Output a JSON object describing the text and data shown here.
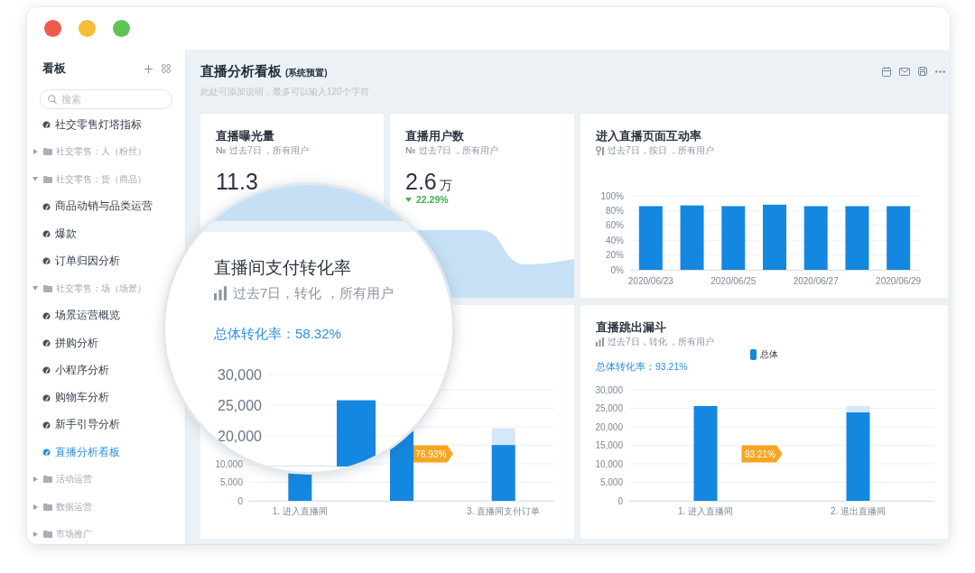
{
  "sidebar": {
    "title": "看板",
    "search": {
      "placeholder": "搜索"
    },
    "items": [
      {
        "kind": "dashboard",
        "label": "社交零售灯塔指标",
        "selected": false
      },
      {
        "kind": "folder",
        "label": "社交零售：人（粉丝）",
        "expanded": false
      },
      {
        "kind": "folder",
        "label": "社交零售：货（商品）",
        "expanded": true,
        "children": [
          {
            "kind": "dashboard",
            "label": "商品动销与品类运营",
            "selected": false
          },
          {
            "kind": "dashboard",
            "label": "爆款",
            "selected": false
          },
          {
            "kind": "dashboard",
            "label": "订单归因分析",
            "selected": false
          }
        ]
      },
      {
        "kind": "folder",
        "label": "社交零售：场（场景）",
        "expanded": true,
        "children": [
          {
            "kind": "dashboard",
            "label": "场景运营概览",
            "selected": false
          },
          {
            "kind": "dashboard",
            "label": "拼购分析",
            "selected": false
          },
          {
            "kind": "dashboard",
            "label": "小程序分析",
            "selected": false
          },
          {
            "kind": "dashboard",
            "label": "购物车分析",
            "selected": false
          },
          {
            "kind": "dashboard",
            "label": "新手引导分析",
            "selected": false
          },
          {
            "kind": "dashboard",
            "label": "直播分析看板",
            "selected": true
          }
        ]
      },
      {
        "kind": "folder",
        "label": "活动运营",
        "expanded": false
      },
      {
        "kind": "folder",
        "label": "数据运营",
        "expanded": false
      },
      {
        "kind": "folder",
        "label": "市场推广",
        "expanded": false
      }
    ]
  },
  "header": {
    "title": "直播分析看板",
    "tag": "(系统预置)",
    "description": "此处可添加说明，最多可以输入120个字符"
  },
  "card_rows": [
    {
      "cards": [
        {
          "kind": "metric",
          "title": "直播曝光量",
          "icon": "№",
          "subtitle": "过去7日 ，所有用户",
          "value": "11.3"
        },
        {
          "kind": "metric",
          "title": "直播用户数",
          "icon": "№",
          "subtitle": "过去7日 ，所有用户",
          "value": "2.6",
          "unit": "万",
          "change": {
            "text": "22.29%",
            "down": true
          },
          "area_chart": true
        },
        {
          "kind": "bar_chart",
          "title": "进入直播页面互动率",
          "subtitle": "过去7日，按日 ，所有用户",
          "chart_data": {
            "type": "bar",
            "categories": [
              "2020/06/23",
              null,
              "2020/06/25",
              null,
              "2020/06/27",
              null,
              "2020/06/29"
            ],
            "ylim": [
              0,
              100
            ],
            "yticks": [
              {
                "value": 0,
                "label": "0%"
              },
              {
                "value": 20,
                "label": "20%"
              },
              {
                "value": 40,
                "label": "40%"
              },
              {
                "value": 60,
                "label": "60%"
              },
              {
                "value": 80,
                "label": "80%"
              },
              {
                "value": 100,
                "label": "100%"
              }
            ],
            "grid": true,
            "series": [
              {
                "color": "#1487e1",
                "values": [
                  86,
                  87,
                  86,
                  88,
                  86,
                  86,
                  86
                ]
              }
            ]
          }
        }
      ]
    },
    {
      "cards": [
        {
          "kind": "funnel",
          "chart_data": {
            "type": "bar",
            "categories": [
              "1. 进入直播间",
              null,
              "3. 直播间支付订单"
            ],
            "ylim": [
              0,
              30000
            ],
            "yticks": [
              {
                "value": 0,
                "label": "0"
              },
              {
                "value": 5000,
                "label": "5,000"
              },
              {
                "value": 10000,
                "label": "10,000"
              }
            ],
            "grid": true,
            "stacked": true,
            "series": [
              {
                "color": "#1487e1",
                "values": [
                  null,
                  null,
                  15100
                ]
              },
              {
                "color": "#d5e7f9",
                "values": [
                  null,
                  null,
                  4500
                ]
              }
            ],
            "annotations": [
              "76.93%"
            ]
          }
        },
        {
          "kind": "funnel",
          "title": "直播跳出漏斗",
          "subtitle": "过去7日，转化 ，所有用户",
          "rate": "总体转化率：93.21%",
          "chart_data": {
            "type": "bar",
            "categories": [
              "1. 进入直播间",
              "2. 退出直播间"
            ],
            "ylim": [
              0,
              30000
            ],
            "yticks": [
              {
                "value": 0,
                "label": "0"
              },
              {
                "value": 5000,
                "label": "5,000"
              },
              {
                "value": 10000,
                "label": "10,000"
              },
              {
                "value": 15000,
                "label": "15,000"
              },
              {
                "value": 20000,
                "label": "20,000"
              },
              {
                "value": 25000,
                "label": "25,000"
              },
              {
                "value": 30000,
                "label": "30,000"
              }
            ],
            "grid": true,
            "stacked": true,
            "series": [
              {
                "name": "总体",
                "color": "#1487e1",
                "values": [
                  25600,
                  23900
                ]
              },
              {
                "color": "#d5e7f9",
                "values": [
                  null,
                  1700
                ]
              }
            ],
            "annotations": [
              "93.21%"
            ]
          }
        }
      ]
    }
  ],
  "magnifier": {
    "title": "直播间支付转化率",
    "subtitle": "过去7日，转化 ，所有用户",
    "rate": "总体转化率：58.32%",
    "chart_data": {
      "type": "bar",
      "categories": [
        null
      ],
      "ylim": [
        15000,
        30000
      ],
      "yticks": [
        {
          "value": 20000,
          "label": "20,000"
        },
        {
          "value": 25000,
          "label": "25,000"
        },
        {
          "value": 30000,
          "label": "30,000"
        }
      ],
      "grid": true,
      "series": [
        {
          "color": "#1487e1",
          "values": [
            25800
          ]
        }
      ]
    }
  }
}
